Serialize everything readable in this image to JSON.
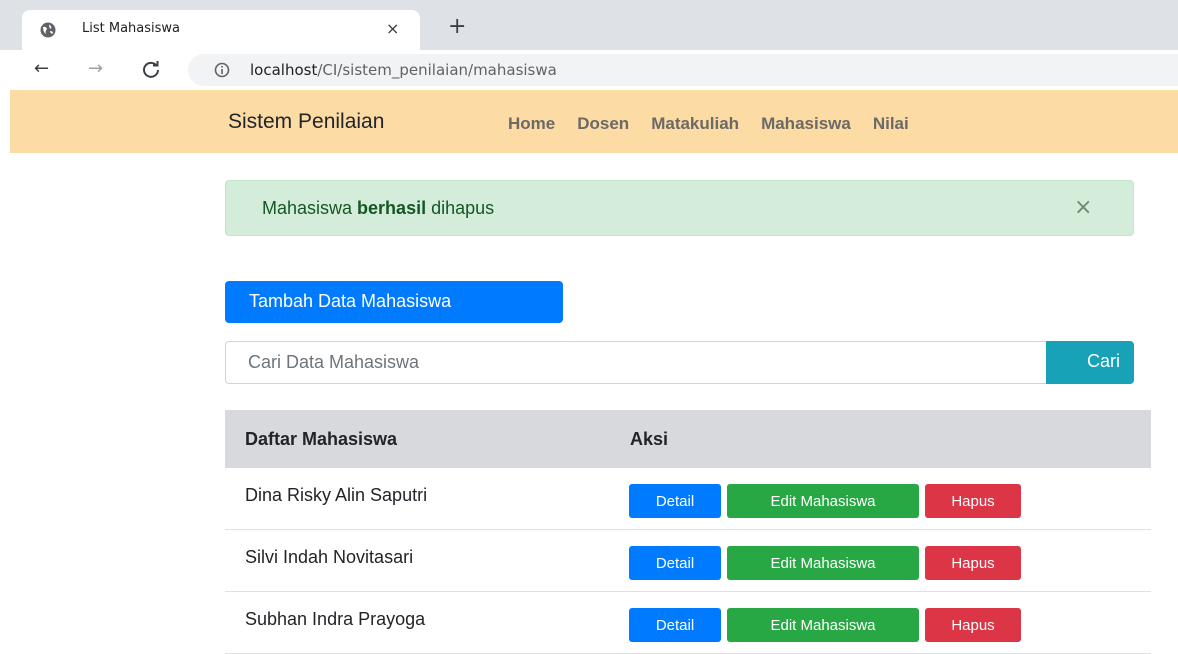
{
  "browser": {
    "tab_title": "List Mahasiswa",
    "tab_close": "×",
    "new_tab": "+",
    "url_host": "localhost",
    "url_path": "/CI/sistem_penilaian/mahasiswa",
    "back_icon": "←",
    "forward_icon": "→",
    "reload_icon": "C"
  },
  "navbar": {
    "brand": "Sistem Penilaian",
    "links": [
      "Home",
      "Dosen",
      "Matakuliah",
      "Mahasiswa",
      "Nilai"
    ],
    "background": "#fcdba5"
  },
  "alert": {
    "prefix": "Mahasiswa ",
    "bold": "berhasil",
    "suffix": " dihapus",
    "close": "×"
  },
  "actions": {
    "add_label": "Tambah Data Mahasiswa",
    "search_placeholder": "Cari Data Mahasiswa",
    "search_label": "Cari"
  },
  "table": {
    "headers": [
      "Daftar Mahasiswa",
      "Aksi"
    ],
    "rows": [
      {
        "name": "Dina Risky Alin Saputri"
      },
      {
        "name": "Silvi Indah Novitasari"
      },
      {
        "name": "Subhan Indra Prayoga"
      }
    ],
    "row_buttons": {
      "detail": "Detail",
      "edit": "Edit Mahasiswa",
      "delete": "Hapus"
    }
  },
  "colors": {
    "primary": "#007bff",
    "success": "#28a745",
    "danger": "#dc3545",
    "info": "#17a2b8",
    "alert_bg": "#d4edda"
  }
}
